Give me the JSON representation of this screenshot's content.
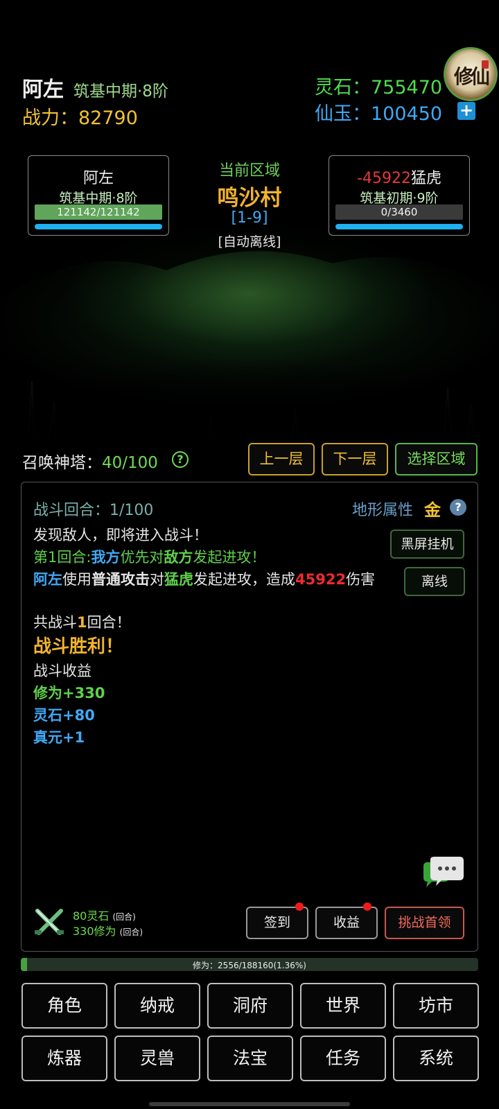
{
  "header": {
    "player_name": "阿左",
    "realm": "筑基中期·8阶",
    "power_label": "战力：",
    "power_value": "82790",
    "lingshi_label": "灵石：",
    "lingshi_value": "755470",
    "xianyu_label": "仙玉：",
    "xianyu_value": "100450",
    "plus_label": "+",
    "logo_text": "修仙"
  },
  "player_card": {
    "name": "阿左",
    "realm": "筑基中期·8阶",
    "hp_text": "121142/121142",
    "hp_fraction": 1.0
  },
  "enemy_card": {
    "damage_text": "-45922",
    "name": "猛虎",
    "realm": "筑基初期·9阶",
    "hp_text": "0/3460",
    "hp_fraction": 0.0
  },
  "area": {
    "label": "当前区域",
    "name": "鸣沙村",
    "range": "[1-9]",
    "auto": "[自动离线]"
  },
  "tower": {
    "label": "召唤神塔：",
    "value": "40/100",
    "help": "?",
    "btn_up": "上一层",
    "btn_down": "下一层",
    "btn_select": "选择区域"
  },
  "battle": {
    "round_label": "战斗回合：1/100",
    "terrain_label": "地形属性",
    "terrain_value": "金",
    "terrain_help": "?",
    "btn_blackscreen": "黑屏挂机",
    "btn_offline": "离线",
    "log": {
      "line1": "发现敌人，即将进入战斗！",
      "line2_a": "第1回合:",
      "line2_b": "我方",
      "line2_c": "优先对",
      "line2_d": "敌方",
      "line2_e": "发起进攻！",
      "line3_a": "阿左",
      "line3_b": "使用",
      "line3_c": "普通攻击",
      "line3_d": "对",
      "line3_e": "猛虎",
      "line3_f": "发起进攻，造成",
      "line3_g": "45922",
      "line3_h": "伤害",
      "line4_a": "共战斗",
      "line4_b": "1",
      "line4_c": "回合！",
      "victory": "战斗胜利！",
      "rewards_title": "战斗收益",
      "reward_xiuwei": "修为+330",
      "reward_lingshi": "灵石+80",
      "reward_zhenyuan": "真元+1"
    },
    "reward_summary": {
      "line1_main": "80灵石",
      "line1_small": "(回合)",
      "line2_main": "330修为",
      "line2_small": "(回合)"
    },
    "btn_signin": "签到",
    "btn_income": "收益",
    "btn_challenge": "挑战首领"
  },
  "progress": {
    "text": "修为：2556/188160(1.36%)",
    "fraction": 0.0136
  },
  "menu": {
    "row1": [
      "角色",
      "纳戒",
      "洞府",
      "世界",
      "坊市"
    ],
    "row2": [
      "炼器",
      "灵兽",
      "法宝",
      "任务",
      "系统"
    ]
  },
  "colors": {
    "gold": "#f2b32e",
    "green": "#5fd14a",
    "blue": "#3fa9f5",
    "red": "#ef2b2b"
  }
}
